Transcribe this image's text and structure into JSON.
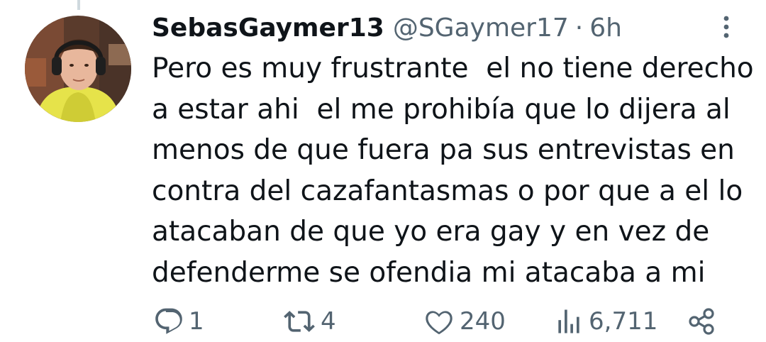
{
  "tweet": {
    "display_name": "SebasGaymer13",
    "handle": "@SGaymer17",
    "separator": "·",
    "time": "6h",
    "text_lines": [
      "Pero es muy frustrante  el no tiene derecho",
      "a estar ahi  el me prohibía que lo dijera al",
      "menos de que fuera pa sus entrevistas en",
      "contra del cazafantasmas o por que a el lo",
      "atacaban de que yo era gay y en vez de",
      "defenderme se ofendia mi atacaba a mi"
    ]
  },
  "actions": {
    "replies": "1",
    "retweets": "4",
    "likes": "240",
    "views": "6,711"
  },
  "icons": {
    "reply": "reply-icon",
    "retweet": "retweet-icon",
    "like": "heart-icon",
    "views": "views-icon",
    "share": "share-icon",
    "more": "more-options-icon"
  },
  "colors": {
    "text": "#0f1419",
    "secondary": "#536471",
    "thread_line": "#cfd9de"
  }
}
